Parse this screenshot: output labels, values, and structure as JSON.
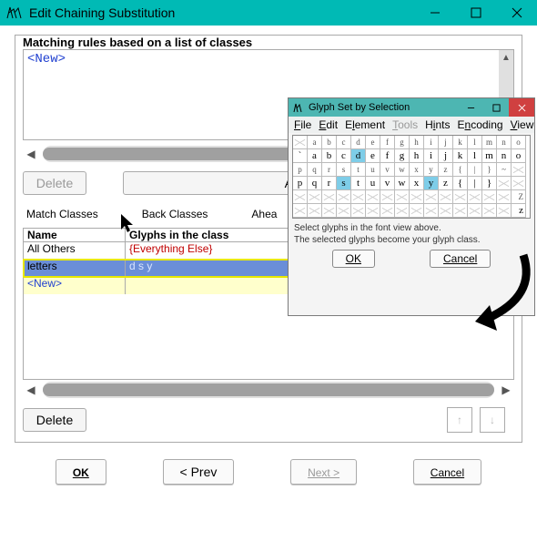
{
  "mainWindow": {
    "title": "Edit Chaining Substitution",
    "groupLabel": "Matching rules based on a list of classes",
    "rulesNew": "<New>",
    "deleteRuleBtn": "Delete",
    "addLookupBtn": "Add Lookup",
    "tabs": {
      "match": "Match Classes",
      "back": "Back Classes",
      "ahead": "Ahea"
    },
    "classTable": {
      "headers": {
        "name": "Name",
        "glyphs": "Glyphs in the class"
      },
      "rows": [
        {
          "name": "All Others",
          "glyphs": "{Everything Else}",
          "kind": "others"
        },
        {
          "name": "letters",
          "glyphs": "d s y",
          "kind": "selected"
        },
        {
          "name": "<New>",
          "glyphs": "",
          "kind": "new"
        }
      ]
    },
    "deleteClassBtn": "Delete",
    "bottomButtons": {
      "ok": "OK",
      "prev": "< Prev",
      "next": "Next >",
      "cancel": "Cancel"
    }
  },
  "glyphDialog": {
    "title": "Glyph Set by Selection",
    "menu": [
      "File",
      "Edit",
      "Element",
      "Tools",
      "Hints",
      "Encoding",
      "View"
    ],
    "menuDisabled": [
      3
    ],
    "grid": {
      "row1_small": [
        "",
        "a",
        "b",
        "c",
        "d",
        "e",
        "f",
        "g",
        "h",
        "i",
        "j",
        "k",
        "l",
        "m",
        "n",
        "o"
      ],
      "row2": [
        "`",
        "a",
        "b",
        "c",
        "d",
        "e",
        "f",
        "g",
        "h",
        "i",
        "j",
        "k",
        "l",
        "m",
        "n",
        "o"
      ],
      "row3_small": [
        "p",
        "q",
        "r",
        "s",
        "t",
        "u",
        "v",
        "w",
        "x",
        "y",
        "z",
        "{",
        "|",
        "}",
        "~",
        ""
      ],
      "row4": [
        "p",
        "q",
        "r",
        "s",
        "t",
        "u",
        "v",
        "w",
        "x",
        "y",
        "z",
        "{",
        "|",
        "}",
        "",
        ""
      ],
      "row5_right": "Z",
      "row6_right": "z"
    },
    "selectedGlyphs": [
      "d",
      "s",
      "y"
    ],
    "hint1": "Select glyphs in the font view above.",
    "hint2": "The selected glyphs become your glyph class.",
    "ok": "OK",
    "cancel": "Cancel"
  }
}
